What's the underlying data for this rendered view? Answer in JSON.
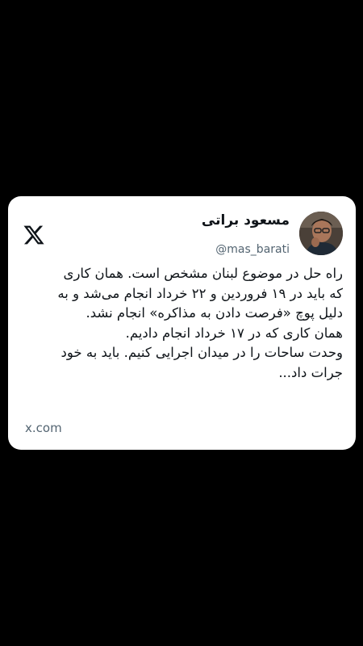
{
  "card": {
    "platform_icon": "x-logo-icon",
    "author": {
      "name": "مسعود براتی",
      "handle": "@mas_barati",
      "avatar_icon": "profile-photo"
    },
    "text_lines": [
      "راه حل در موضوع لبنان مشخص است. همان کاری",
      "که باید در ۱۹ فروردین و ۲۲ خرداد انجام می‌شد و به",
      "دلیل پوچ «فرصت دادن به مذاکره» انجام نشد.",
      "همان کاری که در ۱۷ خرداد انجام دادیم.",
      "وحدت ساحات را در میدان اجرایی کنیم. باید به خود",
      "جرات داد..."
    ],
    "link_domain": "x.com"
  },
  "colors": {
    "background": "#000000",
    "card": "#ffffff",
    "text_primary": "#0f1419",
    "text_secondary": "#536471"
  }
}
